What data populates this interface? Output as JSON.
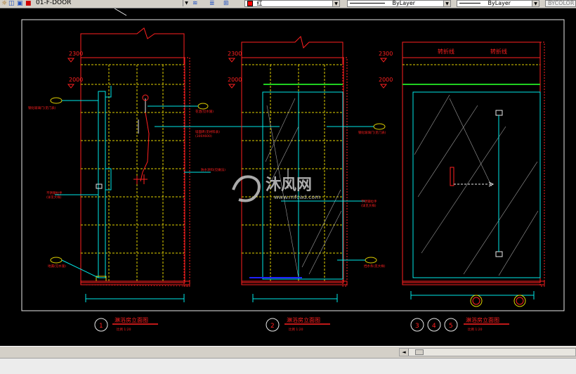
{
  "toolbar": {
    "layer_name": "01-F-DOOR",
    "color_name": "红",
    "linetype": "ByLayer",
    "lineweight": "ByLayer",
    "plotstyle": "BYCOLOR"
  },
  "drawing": {
    "levels": [
      "2300",
      "2000"
    ],
    "cut_labels": [
      "转折线",
      "转折线"
    ],
    "callouts": {
      "a1": "钢化玻璃门(见门表)",
      "a2": "不锈钢拉手\n(详见大样)",
      "a3": "地漏(见水施)",
      "b1": "花洒(见水施)",
      "b2": "墙面砖(见材料表)\n(300X600)",
      "b3": "防水涂料(见做法)",
      "c1": "钢化玻璃门(见门表)",
      "c2": "不锈钢拉手\n(详见大样)",
      "c3": "挡水条(见大样)"
    },
    "titles": [
      {
        "num": "1",
        "name": "淋浴房立面图",
        "scale": "比例 1:20"
      },
      {
        "num": "2",
        "name": "淋浴房立面图",
        "scale": "比例 1:20"
      },
      {
        "nums": [
          "3",
          "4",
          "5"
        ],
        "name": "淋浴房立面图",
        "scale": "比例 1:20"
      }
    ],
    "watermark": {
      "brand": "沐风网",
      "url": "www.mfcad.com"
    }
  },
  "colors": {
    "red": "#ff2020",
    "yellow": "#e0d000",
    "cyan": "#00e8e8",
    "white": "#e8e8e8",
    "green": "#20d020",
    "gray": "#a0a0a0"
  }
}
